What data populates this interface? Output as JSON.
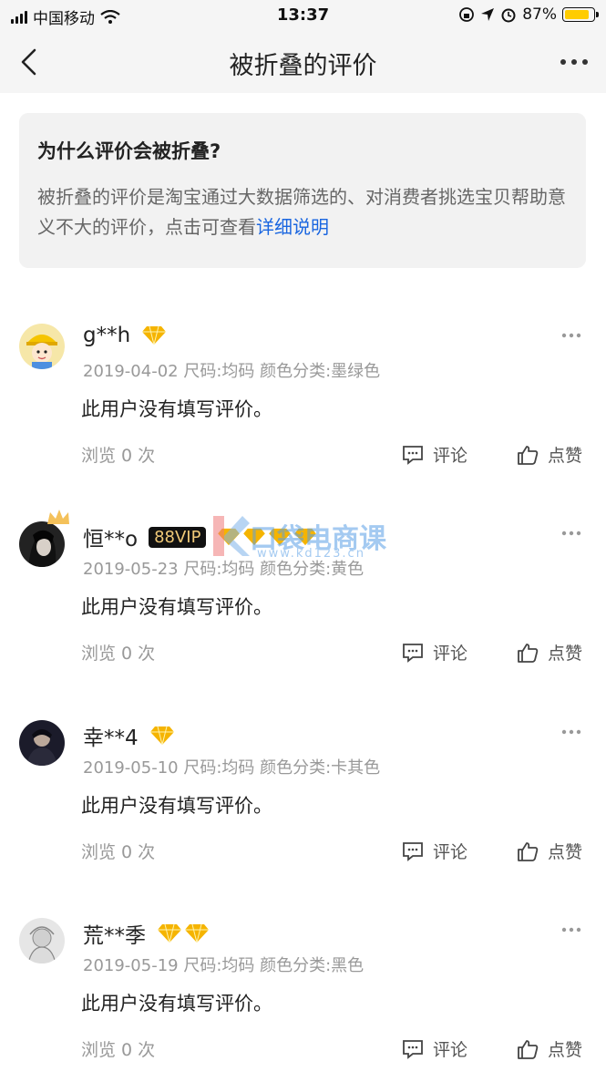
{
  "status_bar": {
    "carrier": "中国移动",
    "time": "13:37",
    "battery": "87%",
    "battery_level": 0.87
  },
  "nav": {
    "title": "被折叠的评价"
  },
  "info": {
    "title": "为什么评价会被折叠?",
    "text": "被折叠的评价是淘宝通过大数据筛选的、对消费者挑选宝贝帮助意义不大的评价，点击可查看",
    "link": "详细说明"
  },
  "reviews": [
    {
      "user": "g**h",
      "meta": "2019-04-02 尺码:均码 颜色分类:墨绿色",
      "content": "此用户没有填写评价。",
      "views": "浏览 0 次",
      "comment": "评论",
      "like": "点赞"
    },
    {
      "user": "恒**o",
      "vip": "88VIP",
      "meta": "2019-05-23 尺码:均码 颜色分类:黄色",
      "content": "此用户没有填写评价。",
      "views": "浏览 0 次",
      "comment": "评论",
      "like": "点赞"
    },
    {
      "user": "幸**4",
      "meta": "2019-05-10 尺码:均码 颜色分类:卡其色",
      "content": "此用户没有填写评价。",
      "views": "浏览 0 次",
      "comment": "评论",
      "like": "点赞"
    },
    {
      "user": "荒**季",
      "meta": "2019-05-19 尺码:均码 颜色分类:黑色",
      "content": "此用户没有填写评价。",
      "views": "浏览 0 次",
      "comment": "评论",
      "like": "点赞"
    }
  ],
  "watermark": {
    "text": "口袋电商课",
    "url": "www.kd123.cn"
  },
  "colors": {
    "link": "#1a66e0",
    "diamond": "#f5b400",
    "battery": "#ffcc00"
  }
}
